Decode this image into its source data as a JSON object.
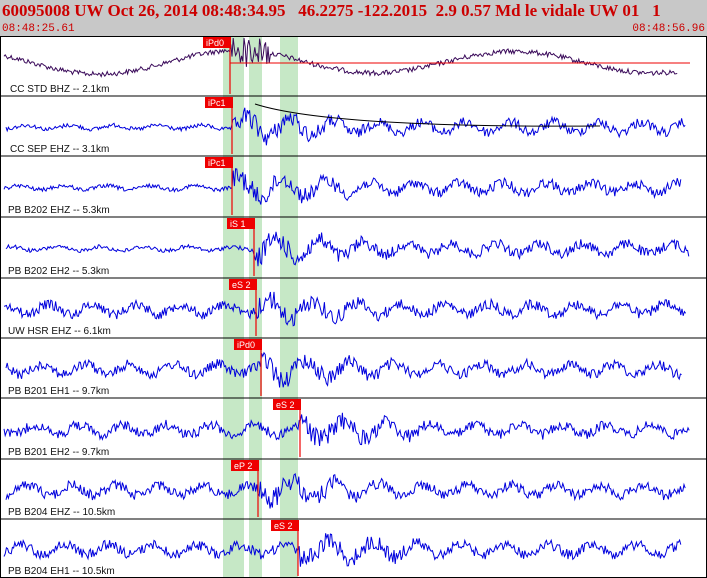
{
  "header": {
    "event_line": "60095008 UW Oct 26, 2014 08:48:34.95   46.2275 -122.2015  2.9 0.57 Md le vidale UW 01   1",
    "time_start": "08:48:25.61",
    "time_end": "08:48:56.96"
  },
  "colors": {
    "header_text": "#cc0000",
    "header_bg": "#c8c8c8",
    "trace": "#0000dd",
    "trace_first": "#3a0a5a",
    "pick": "#ee0000",
    "window": "#c6e8c6"
  },
  "channels": [
    {
      "label": "CC STD BHZ -- 2.1km",
      "picks": [
        "iPd0"
      ]
    },
    {
      "label": "CC SEP EHZ -- 3.1km",
      "picks": [
        "iPc1"
      ]
    },
    {
      "label": "PB B202 EHZ -- 5.3km",
      "picks": [
        "iPc1"
      ]
    },
    {
      "label": "PB B202 EH2 -- 5.3km",
      "picks": [
        "iS 1"
      ]
    },
    {
      "label": "UW HSR EHZ -- 6.1km",
      "picks": [
        "eS 2"
      ]
    },
    {
      "label": "PB B201 EH1 -- 9.7km",
      "picks": [
        "iPd0"
      ]
    },
    {
      "label": "PB B201 EH2 -- 9.7km",
      "picks": [
        "eS 2"
      ]
    },
    {
      "label": "PB B204 EHZ -- 10.5km",
      "picks": [
        "eP 2"
      ]
    },
    {
      "label": "PB B204 EH1 -- 10.5km",
      "picks": [
        "eS 2"
      ]
    }
  ]
}
